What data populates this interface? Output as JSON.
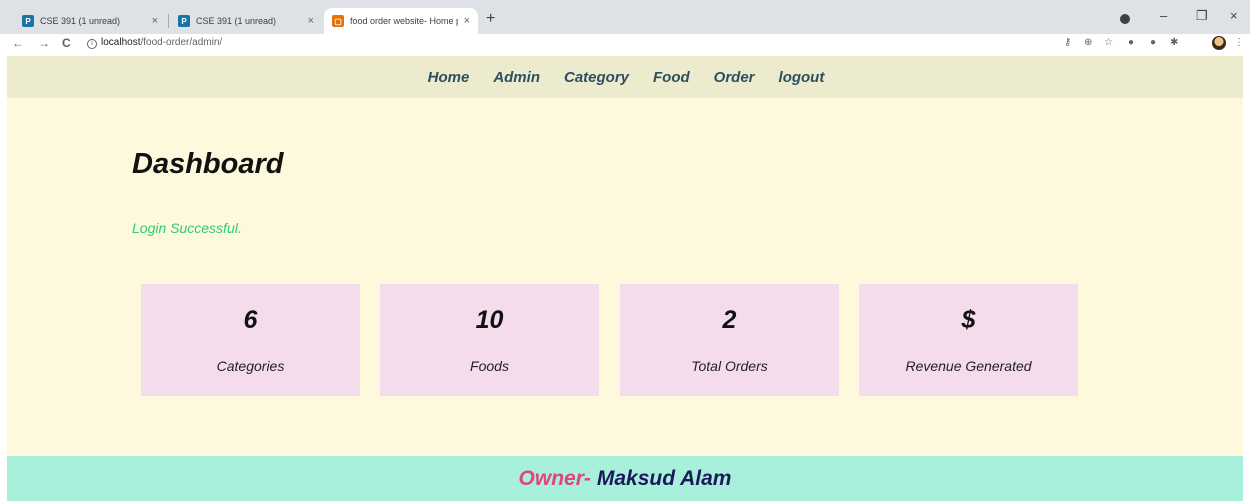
{
  "browser": {
    "tabs": [
      {
        "title": "CSE 391 (1 unread)",
        "favicon": "P",
        "close": "×"
      },
      {
        "title": "CSE 391 (1 unread)",
        "favicon": "P",
        "close": "×"
      },
      {
        "title": "food order website- Home page",
        "favicon": "▢",
        "close": "×"
      }
    ],
    "new_tab": "+",
    "window_controls": {
      "minimize": "–",
      "maximize": "❐",
      "close": "×"
    },
    "nav": {
      "back": "←",
      "forward": "→",
      "reload": "C"
    },
    "url_host": "localhost",
    "url_path": "/food-order/admin/",
    "info_icon": "i"
  },
  "nav": {
    "items": [
      "Home",
      "Admin",
      "Category",
      "Food",
      "Order",
      "logout"
    ]
  },
  "main": {
    "title": "Dashboard",
    "login_message": "Login Successful."
  },
  "cards": [
    {
      "value": "6",
      "label": "Categories"
    },
    {
      "value": "10",
      "label": "Foods"
    },
    {
      "value": "2",
      "label": "Total Orders"
    },
    {
      "value": "$",
      "label": "Revenue Generated"
    }
  ],
  "footer": {
    "owner_label": "Owner-",
    "owner_name": "Maksud Alam"
  },
  "colors": {
    "page_bg": "#fef9dc",
    "nav_bg": "#ecebcd",
    "card_bg": "#f5dced",
    "footer_bg": "#a8f0dc",
    "success": "#2ecc71",
    "owner_label": "#e0457b",
    "owner_name": "#1b1b5a"
  }
}
